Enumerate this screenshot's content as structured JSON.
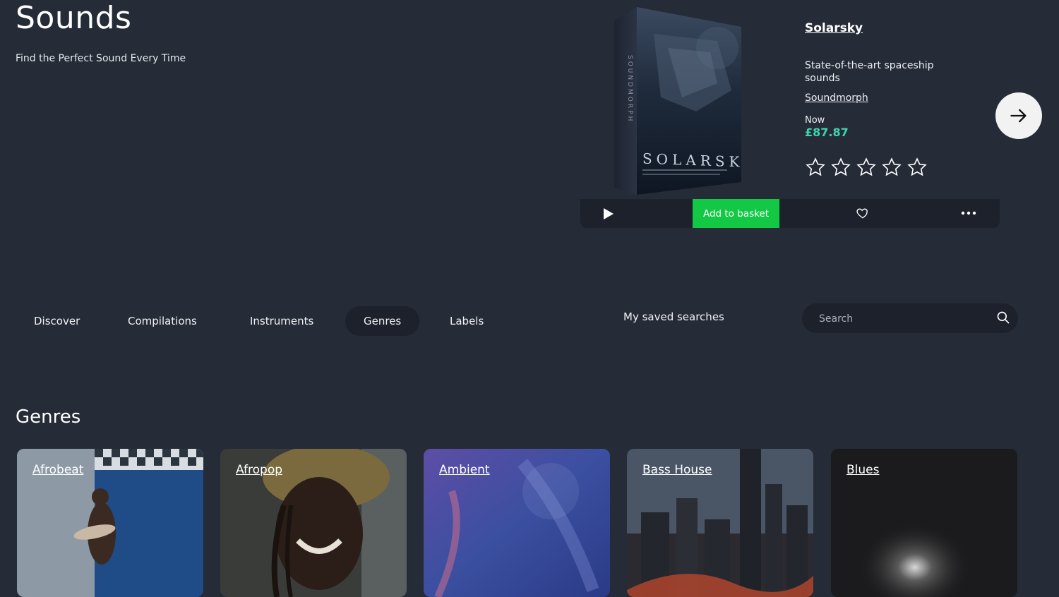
{
  "header": {
    "title": "Sounds",
    "subtitle": "Find the Perfect Sound Every Time"
  },
  "featured": {
    "box_text": "SOLARSKY",
    "box_brand": "SOUNDMORPH",
    "title": "Solarsky",
    "description": "State-of-the-art spaceship sounds",
    "vendor": "Soundmorph",
    "price_label": "Now",
    "price": "£87.87",
    "rating": 0,
    "rating_max": 5,
    "add_to_basket_label": "Add to basket",
    "icons": {
      "play": "play-icon",
      "wishlist": "heart-icon",
      "more": "more-dots-icon",
      "next": "arrow-right-icon"
    }
  },
  "nav": {
    "items": [
      {
        "label": "Discover",
        "active": false
      },
      {
        "label": "Compilations",
        "active": false
      },
      {
        "label": "Instruments",
        "active": false
      },
      {
        "label": "Genres",
        "active": true
      },
      {
        "label": "Labels",
        "active": false
      }
    ],
    "saved_searches": "My saved searches",
    "search_placeholder": "Search"
  },
  "genres": {
    "title": "Genres",
    "cards": [
      {
        "label": "Afrobeat"
      },
      {
        "label": "Afropop"
      },
      {
        "label": "Ambient"
      },
      {
        "label": "Bass House"
      },
      {
        "label": "Blues"
      }
    ]
  },
  "colors": {
    "background": "#252b37",
    "panel": "#1c212b",
    "accent_green": "#12c845",
    "price_teal": "#3fd4b0"
  }
}
